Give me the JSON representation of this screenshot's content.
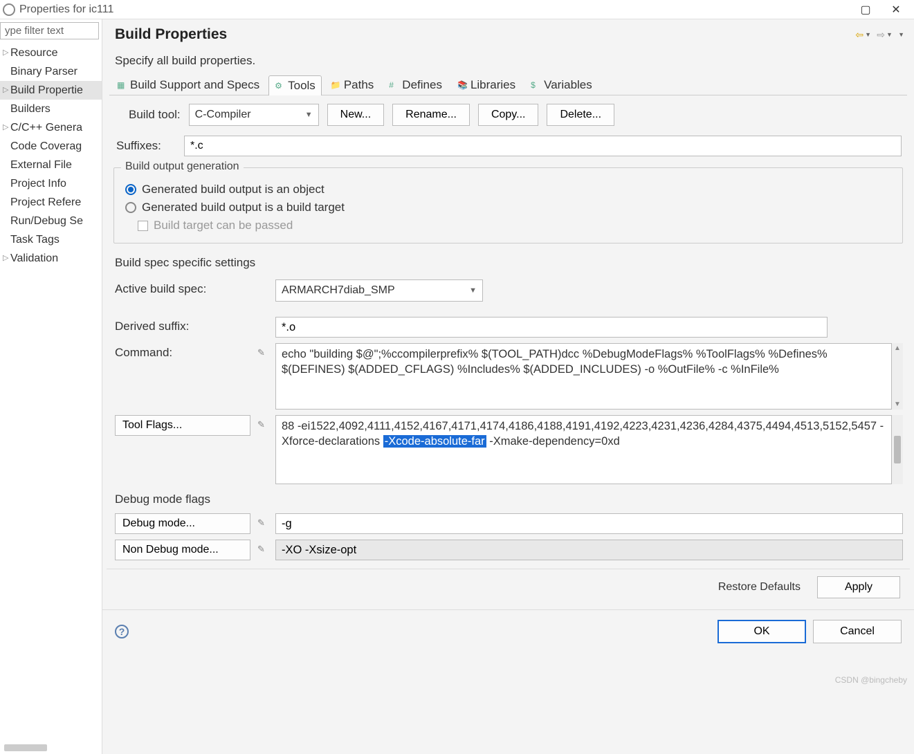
{
  "window": {
    "title": "Properties for ic111"
  },
  "filter_placeholder": "ype filter text",
  "tree": [
    {
      "label": "Resource",
      "exp": true
    },
    {
      "label": "Binary Parser"
    },
    {
      "label": "Build Propertie",
      "exp": true,
      "selected": true
    },
    {
      "label": "Builders"
    },
    {
      "label": "C/C++ Genera",
      "exp": true
    },
    {
      "label": "Code Coverag"
    },
    {
      "label": "External File"
    },
    {
      "label": "Project Info"
    },
    {
      "label": "Project Refere"
    },
    {
      "label": "Run/Debug Se"
    },
    {
      "label": "Task Tags"
    },
    {
      "label": "Validation",
      "exp": true
    }
  ],
  "page": {
    "title": "Build Properties",
    "subtitle": "Specify all build properties.",
    "tabs": [
      {
        "label": "Build Support and Specs"
      },
      {
        "label": "Tools",
        "active": true
      },
      {
        "label": "Paths"
      },
      {
        "label": "Defines"
      },
      {
        "label": "Libraries"
      },
      {
        "label": "Variables"
      }
    ],
    "build_tool_label": "Build tool:",
    "build_tool_value": "C-Compiler",
    "buttons": {
      "new": "New...",
      "rename": "Rename...",
      "copy": "Copy...",
      "delete": "Delete..."
    },
    "suffixes_label": "Suffixes:",
    "suffixes_value": "*.c",
    "outgen": {
      "legend": "Build output generation",
      "opt1": "Generated build output is an object",
      "opt2": "Generated build output is a build target",
      "chk": "Build target can be passed"
    },
    "spec": {
      "legend": "Build spec specific settings",
      "active_label": "Active build spec:",
      "active_value": "ARMARCH7diab_SMP",
      "derived_label": "Derived suffix:",
      "derived_value": "*.o",
      "command_label": "Command:",
      "command_value": "echo \"building $@\";%ccompilerprefix% $(TOOL_PATH)dcc %DebugModeFlags% %ToolFlags% %Defines% $(DEFINES) $(ADDED_CFLAGS) %Includes% $(ADDED_INCLUDES) -o %OutFile% -c %InFile%",
      "toolflags_label": "Tool Flags...",
      "toolflags_pre": "88 -ei1522,4092,4111,4152,4167,4171,4174,4186,4188,4191,4192,4223,4231,4236,4284,4375,4494,4513,5152,5457 -Xforce-declarations   ",
      "toolflags_sel": "-Xcode-absolute-far",
      "toolflags_post": "    -Xmake-dependency=0xd"
    },
    "dmflags": {
      "legend": "Debug mode flags",
      "debug_label": "Debug mode...",
      "debug_value": "-g",
      "nondebug_label": "Non Debug mode...",
      "nondebug_value": "-XO -Xsize-opt"
    },
    "restore": "Restore Defaults",
    "apply": "Apply"
  },
  "dialog": {
    "ok": "OK",
    "cancel": "Cancel"
  },
  "watermark": "CSDN @bingcheby"
}
